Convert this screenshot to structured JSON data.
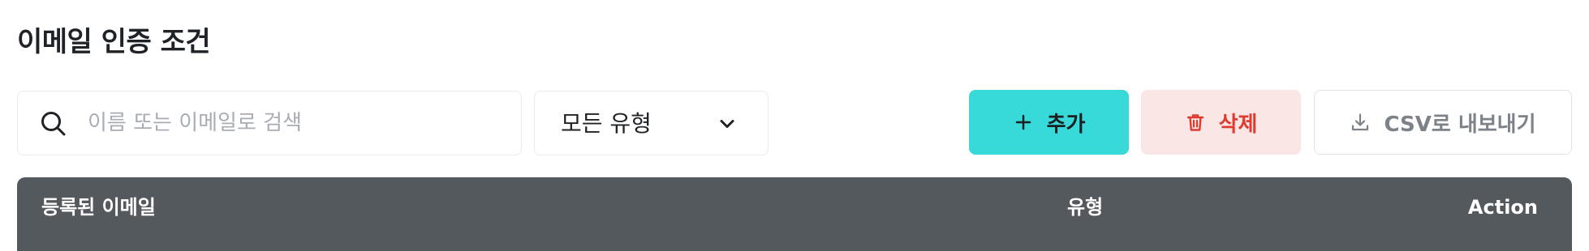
{
  "page": {
    "title": "이메일 인증 조건"
  },
  "search": {
    "placeholder": "이름 또는 이메일로 검색",
    "value": "",
    "icon": "search-icon"
  },
  "filter": {
    "selected": "모든 유형",
    "icon": "chevron-down-icon"
  },
  "actions": {
    "add_label": "추가",
    "add_icon": "plus-icon",
    "delete_label": "삭제",
    "delete_icon": "trash-icon",
    "export_label": "CSV로 내보내기",
    "export_icon": "download-icon"
  },
  "table": {
    "columns": [
      "등록된 이메일",
      "유형",
      "Action"
    ]
  },
  "colors": {
    "accent": "#38d9d9",
    "danger": "#e03b2f",
    "danger_bg": "#f9e6e5",
    "table_header_bg": "#54595d"
  }
}
